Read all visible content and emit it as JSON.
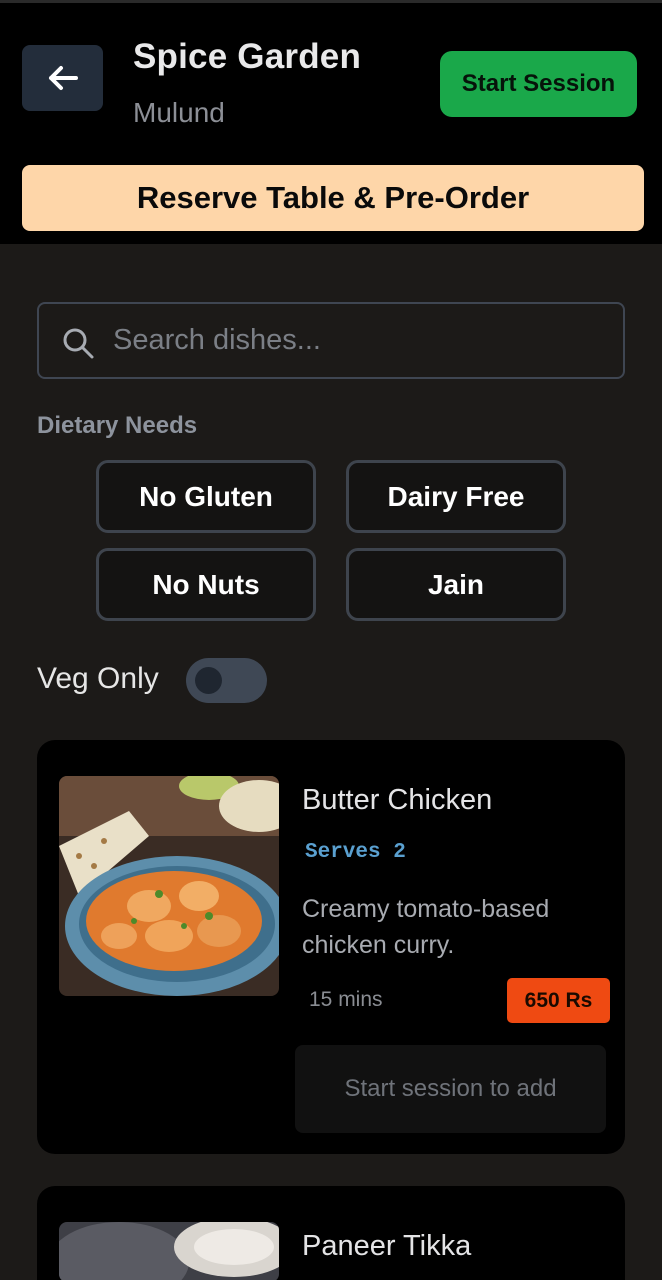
{
  "header": {
    "restaurant_name": "Spice Garden",
    "location": "Mulund",
    "start_session_label": "Start Session",
    "reserve_label": "Reserve Table & Pre-Order"
  },
  "search": {
    "placeholder": "Search dishes...",
    "value": ""
  },
  "dietary": {
    "label": "Dietary Needs",
    "options": [
      "No Gluten",
      "Dairy Free",
      "No Nuts",
      "Jain"
    ]
  },
  "veg_only": {
    "label": "Veg Only",
    "enabled": false
  },
  "dishes": [
    {
      "name": "Butter Chicken",
      "serves": "Serves 2",
      "description": "Creamy tomato-based chicken curry.",
      "time": "15 mins",
      "price": "650 Rs",
      "add_label": "Start session to add"
    },
    {
      "name": "Paneer Tikka"
    }
  ],
  "colors": {
    "header_bg": "#000000",
    "page_bg": "#1c1a18",
    "start_session": "#1aa84a",
    "reserve": "#fed6a9",
    "price_badge": "#ef4a12",
    "serves_text": "#5aa0d0"
  }
}
